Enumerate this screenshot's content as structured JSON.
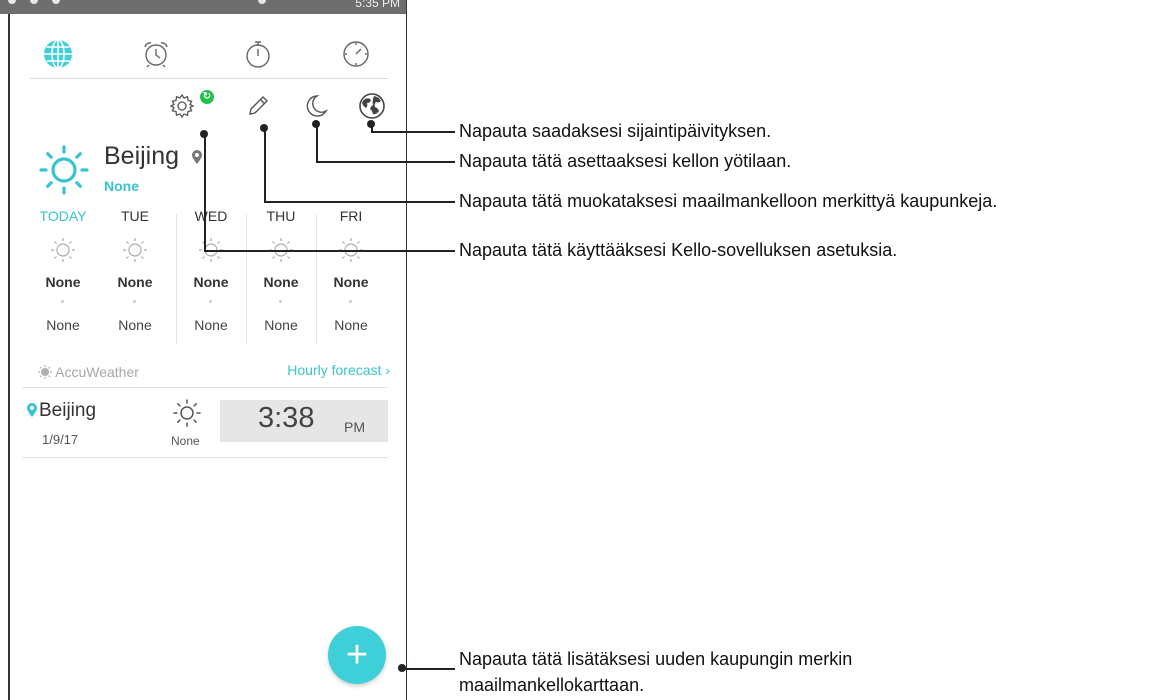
{
  "status_bar": {
    "time": "5:35 PM"
  },
  "tabs": [
    {
      "name": "world-clock",
      "icon": "globe-icon",
      "active": true
    },
    {
      "name": "alarm",
      "icon": "alarm-clock-icon"
    },
    {
      "name": "stopwatch",
      "icon": "stopwatch-icon"
    },
    {
      "name": "timer",
      "icon": "timer-icon"
    }
  ],
  "toolbar": {
    "settings_icon": "gear-icon",
    "sync_badge": "↻",
    "edit_icon": "pencil-icon",
    "night_icon": "moon-icon",
    "location_icon": "earth-icon"
  },
  "weather": {
    "city": "Beijing",
    "condition": "None",
    "forecast": [
      {
        "day": "TODAY",
        "high": "None",
        "low": "None"
      },
      {
        "day": "TUE",
        "high": "None",
        "low": "None"
      },
      {
        "day": "WED",
        "high": "None",
        "low": "None"
      },
      {
        "day": "THU",
        "high": "None",
        "low": "None"
      },
      {
        "day": "FRI",
        "high": "None",
        "low": "None"
      }
    ],
    "provider": "AccuWeather",
    "hourly_link": "Hourly forecast"
  },
  "world_clock": {
    "city": "Beijing",
    "date": "1/9/17",
    "condition": "None",
    "time": "3:38",
    "ampm": "PM"
  },
  "fab_label": "+",
  "callouts": {
    "location_update": "Napauta saadaksesi sijaintipäivityksen.",
    "night_mode": "Napauta tätä asettaaksesi kellon yötilaan.",
    "edit_cities": "Napauta tätä muokataksesi maailmankelloon merkittyä kaupunkeja.",
    "settings": "Napauta tätä käyttääksesi Kello-sovelluksen asetuksia.",
    "add_city_line1": "Napauta tätä lisätäksesi uuden kaupungin merkin",
    "add_city_line2": "maailmankellokarttaan."
  },
  "colors": {
    "accent": "#39c3d1",
    "fab": "#3fcfd9",
    "sync_green": "#23c14a",
    "sun_blue": "#39c3d1"
  }
}
